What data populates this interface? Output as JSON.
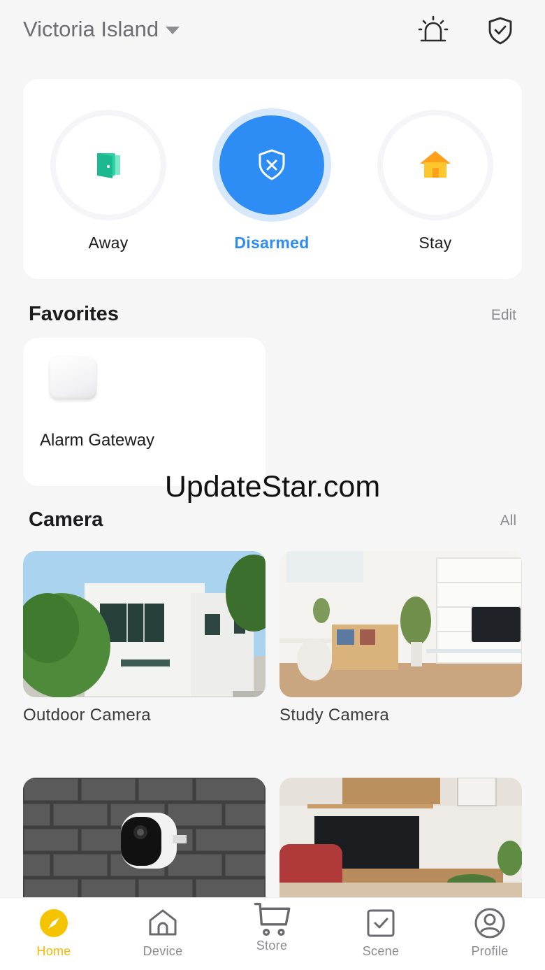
{
  "header": {
    "location": "Victoria Island",
    "icons": [
      "siren-icon",
      "shield-check-icon"
    ]
  },
  "modes": {
    "away": "Away",
    "disarmed": "Disarmed",
    "stay": "Stay",
    "active": "disarmed",
    "active_color": "#2e8df5"
  },
  "favorites": {
    "title": "Favorites",
    "edit": "Edit",
    "items": [
      {
        "name": "Alarm Gateway"
      }
    ]
  },
  "watermark": "UpdateStar.com",
  "camera": {
    "title": "Camera",
    "all": "All",
    "items": [
      {
        "name": "Outdoor Camera"
      },
      {
        "name": "Study Camera"
      },
      {
        "name": ""
      },
      {
        "name": ""
      }
    ]
  },
  "nav": {
    "home": "Home",
    "device": "Device",
    "store": "Store",
    "scene": "Scene",
    "profile": "Profile",
    "active": "home",
    "active_color": "#f5b800"
  }
}
